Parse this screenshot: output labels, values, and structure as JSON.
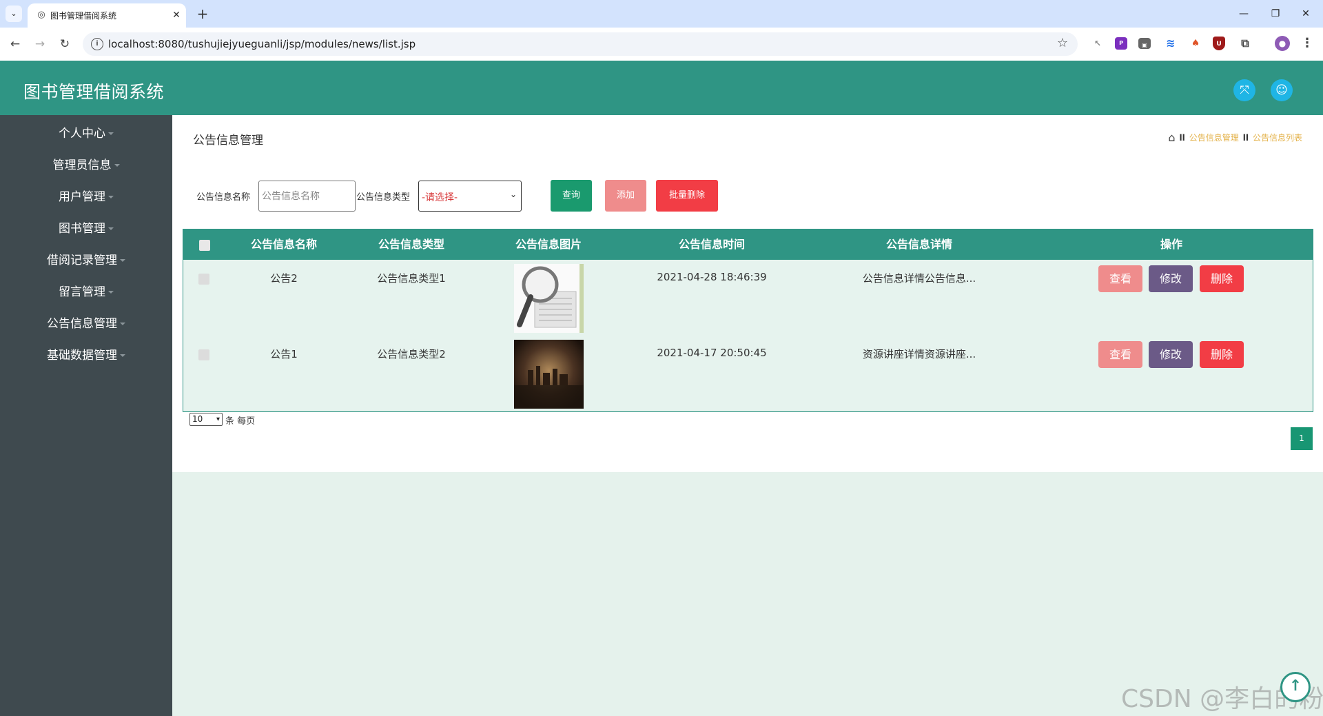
{
  "browser": {
    "tab_title": "图书管理借阅系统",
    "url": "localhost:8080/tushujiejyueguanli/jsp/modules/news/list.jsp",
    "minimize_icon": "minimize-icon",
    "restore_icon": "restore-icon",
    "close_icon": "close-icon"
  },
  "app": {
    "title": "图书管理借阅系统"
  },
  "sidebar": {
    "items": [
      {
        "label": "个人中心"
      },
      {
        "label": "管理员信息"
      },
      {
        "label": "用户管理"
      },
      {
        "label": "图书管理"
      },
      {
        "label": "借阅记录管理"
      },
      {
        "label": "留言管理"
      },
      {
        "label": "公告信息管理"
      },
      {
        "label": "基础数据管理"
      }
    ]
  },
  "page": {
    "heading": "公告信息管理",
    "breadcrumb": [
      "公告信息管理",
      "公告信息列表"
    ]
  },
  "search": {
    "name_label": "公告信息名称",
    "name_placeholder": "公告信息名称",
    "type_label": "公告信息类型",
    "type_selected": "-请选择-",
    "query_label": "查询",
    "add_label": "添加",
    "batch_delete_label": "批量删除"
  },
  "table": {
    "columns": [
      "公告信息名称",
      "公告信息类型",
      "公告信息图片",
      "公告信息时间",
      "公告信息详情",
      "操作"
    ],
    "rows": [
      {
        "name": "公告2",
        "type": "公告信息类型1",
        "image": "news-magnifier-image",
        "time": "2021-04-28 18:46:39",
        "detail": "公告信息详情公告信息..."
      },
      {
        "name": "公告1",
        "type": "公告信息类型2",
        "image": "dark-city-photo",
        "time": "2021-04-17 20:50:45",
        "detail": "资源讲座详情资源讲座..."
      }
    ],
    "actions": {
      "view": "查看",
      "edit": "修改",
      "delete": "删除"
    }
  },
  "pager": {
    "page_size": "10",
    "per_page_text": "条 每页",
    "current_page": "1"
  },
  "watermark": "CSDN @李白的粉",
  "colors": {
    "header": "#2f9584",
    "sidebar": "#3f4a4f",
    "query_button": "#1a9a6e",
    "add_button": "#ef8c8c",
    "delete_button": "#f23d45",
    "edit_button": "#6b5a87"
  }
}
